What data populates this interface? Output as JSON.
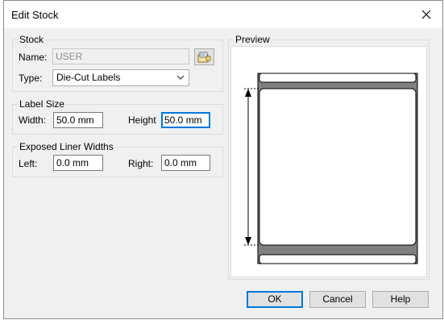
{
  "window": {
    "title": "Edit Stock"
  },
  "stock": {
    "group_label": "Stock",
    "name_label": "Name:",
    "name_value": "USER",
    "type_label": "Type:",
    "type_value": "Die-Cut Labels"
  },
  "label_size": {
    "group_label": "Label Size",
    "width_label": "Width:",
    "width_value": "50.0 mm",
    "height_label": "Height",
    "height_value": "50.0 mm"
  },
  "liner": {
    "group_label": "Exposed Liner Widths",
    "left_label": "Left:",
    "left_value": "0.0 mm",
    "right_label": "Right:",
    "right_value": "0.0 mm"
  },
  "preview": {
    "group_label": "Preview"
  },
  "buttons": {
    "ok": "OK",
    "cancel": "Cancel",
    "help": "Help"
  },
  "icons": {
    "close": "close-icon",
    "browse": "folder-browse-icon",
    "dropdown": "chevron-down-icon"
  }
}
